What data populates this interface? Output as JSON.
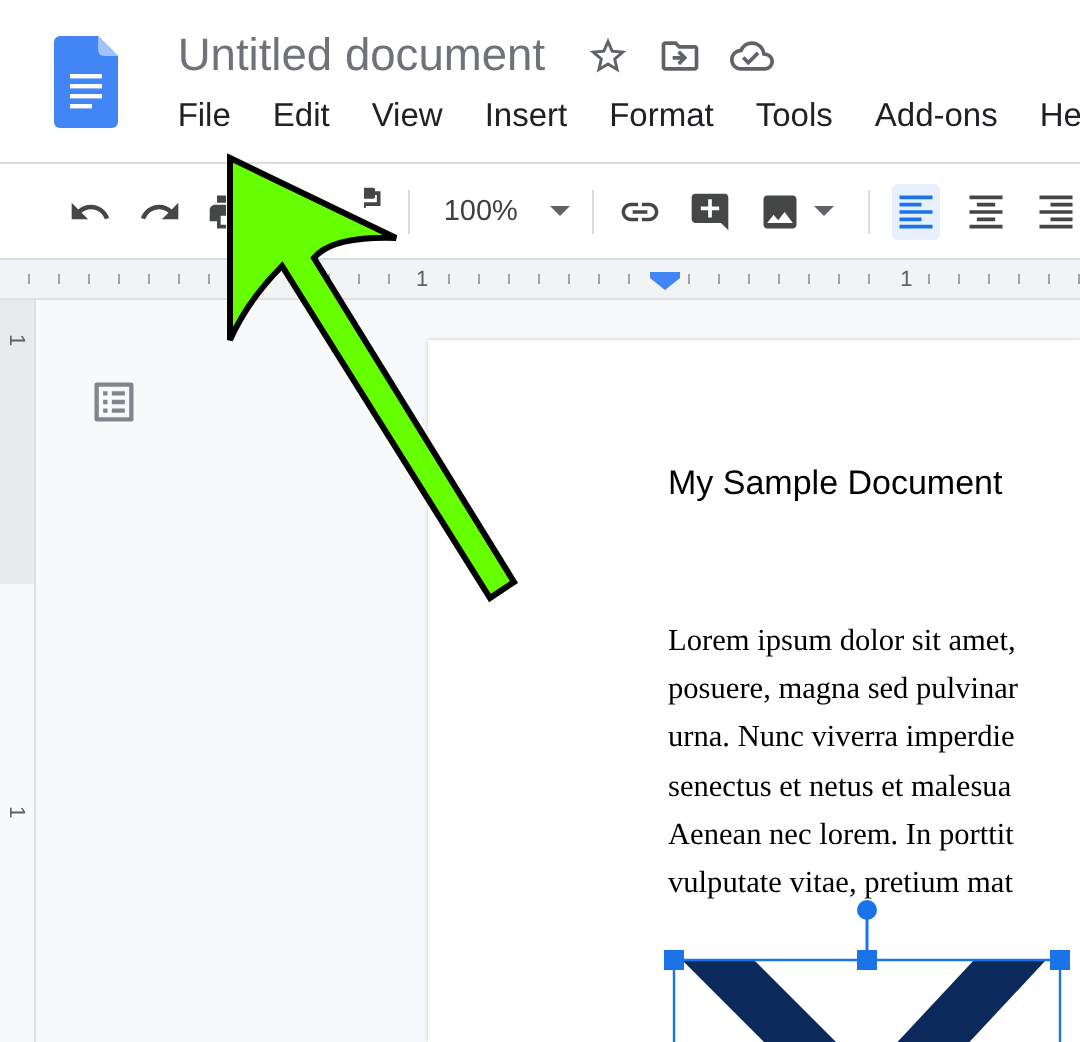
{
  "document_title": "Untitled document",
  "menu": [
    "File",
    "Edit",
    "View",
    "Insert",
    "Format",
    "Tools",
    "Add-ons",
    "He"
  ],
  "toolbar": {
    "zoom": "100%",
    "alignment": [
      {
        "kind": "left",
        "selected": true
      },
      {
        "kind": "center",
        "selected": false
      },
      {
        "kind": "right",
        "selected": false
      }
    ]
  },
  "ruler": {
    "horizontal_labels": [
      "1",
      "1"
    ],
    "vertical_labels": [
      "1",
      "1"
    ]
  },
  "document": {
    "heading": "My Sample Document",
    "paragraph_lines": [
      "Lorem ipsum dolor sit amet,",
      "posuere, magna sed pulvinar",
      "urna. Nunc viverra imperdie",
      "senectus et netus et malesua",
      "Aenean nec lorem. In porttit",
      "vulputate vitae, pretium mat"
    ],
    "image": {
      "kind": "picture",
      "selected": true
    }
  }
}
